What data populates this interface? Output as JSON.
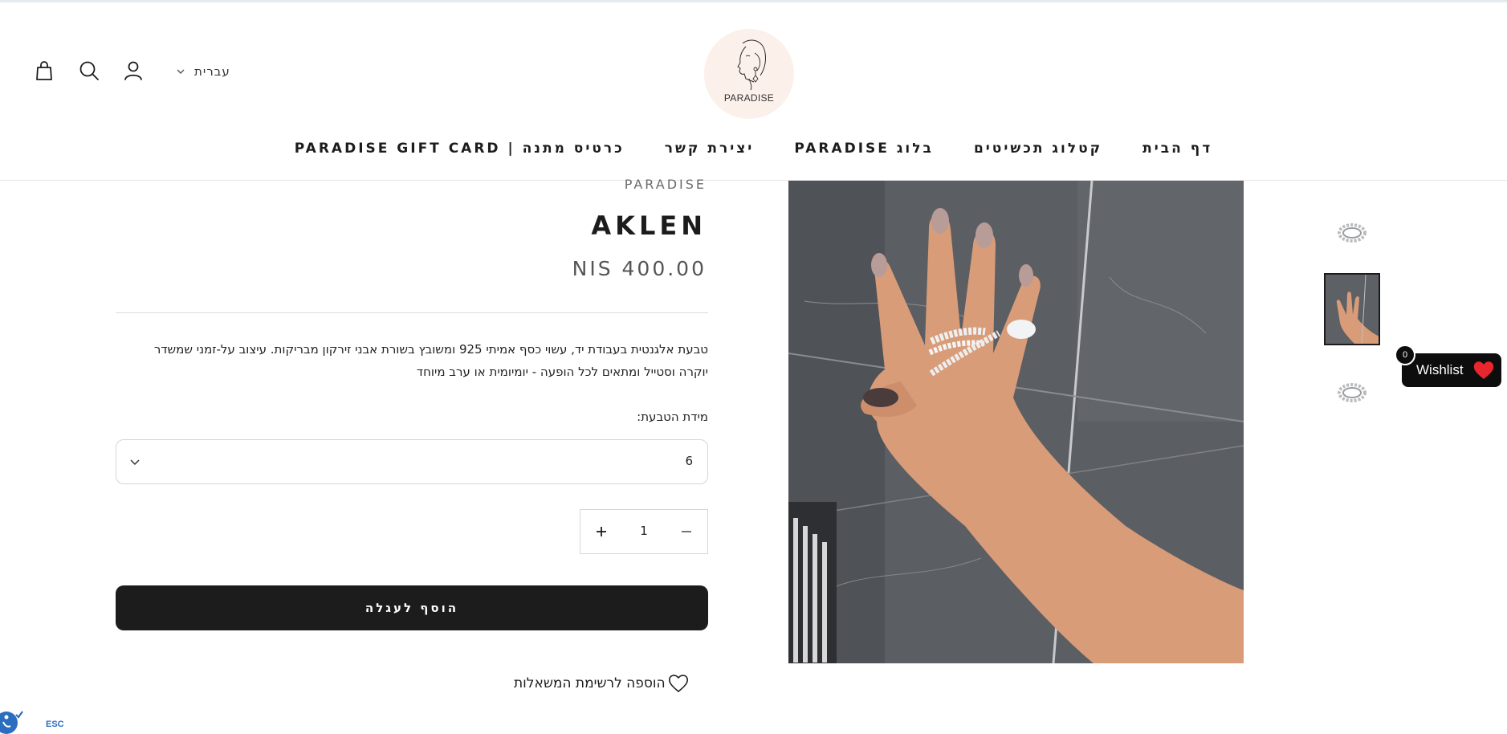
{
  "header": {
    "language": "עברית",
    "logo_text": "PARADISE",
    "nav": [
      {
        "label": "דף הבית"
      },
      {
        "label": "קטלוג תכשיטים"
      },
      {
        "label": "בלוג PARADISE"
      },
      {
        "label": "יצירת קשר"
      },
      {
        "label": "כרטיס מתנה | PARADISE GIFT CARD"
      }
    ]
  },
  "product": {
    "vendor": "PARADISE",
    "title": "AKLEN",
    "price": "NIS 400.00",
    "description_line1": "טבעת אלגנטית בעבודת יד, עשוי כסף אמיתי 925 ומשובץ בשורת אבני זירקון מבריקות. עיצוב על-זמני שמשדר",
    "description_line2": "יוקרה וסטייל ומתאים לכל הופעה - יומיומית או ערב מיוחד",
    "size_label": "מידת הטבעת:",
    "size_value": "6",
    "quantity": "1",
    "add_to_cart": "הוסף לעגלה",
    "add_to_wishlist": "הוספה לרשימת המשאלות"
  },
  "wishlist_widget": {
    "label": "Wishlist",
    "count": "0"
  },
  "accessibility": {
    "esc_label": "ESC"
  },
  "colors": {
    "primary_button": "#1c1c1c",
    "wishlist_heart": "#e8262d",
    "logo_bg": "#fbf0ea"
  },
  "icons": [
    "cart-icon",
    "search-icon",
    "account-icon",
    "chevron-down-icon",
    "plus-icon",
    "minus-icon",
    "heart-icon",
    "accessibility-icon"
  ]
}
